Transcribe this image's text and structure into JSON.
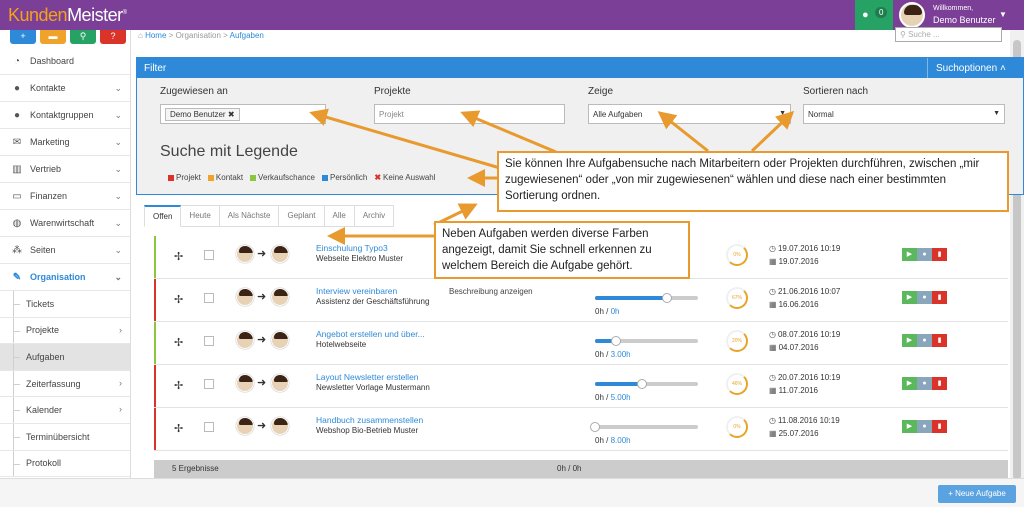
{
  "app": {
    "logo_kunden": "Kunden",
    "logo_meister": "Meister",
    "logo_mark": "®"
  },
  "header": {
    "notification_count": "0",
    "welcome": "Willkommen,",
    "user_name": "Demo Benutzer"
  },
  "colors": {
    "brand": "#7b3f97",
    "accent": "#2e8ad8",
    "notify": "#27a265",
    "callout_border": "#e89a2e"
  },
  "sidebar": {
    "quick_buttons": [
      {
        "icon": "plus-icon",
        "glyph": "+",
        "color": "#2e8ad8"
      },
      {
        "icon": "chat-icon",
        "glyph": "▬",
        "color": "#f0a32a"
      },
      {
        "icon": "search-icon",
        "glyph": "⚲",
        "color": "#27a265"
      },
      {
        "icon": "help-icon",
        "glyph": "?",
        "color": "#d9332a"
      }
    ],
    "items": [
      {
        "label": "Dashboard",
        "icon": "dashboard-icon",
        "glyph": "◔"
      },
      {
        "label": "Kontakte",
        "icon": "user-icon",
        "glyph": "●"
      },
      {
        "label": "Kontaktgruppen",
        "icon": "users-icon",
        "glyph": "●"
      },
      {
        "label": "Marketing",
        "icon": "envelope-icon",
        "glyph": "✉"
      },
      {
        "label": "Vertrieb",
        "icon": "bar-chart-icon",
        "glyph": "▥"
      },
      {
        "label": "Finanzen",
        "icon": "money-icon",
        "glyph": "▭"
      },
      {
        "label": "Warenwirtschaft",
        "icon": "globe-icon",
        "glyph": "◍"
      },
      {
        "label": "Seiten",
        "icon": "sitemap-icon",
        "glyph": "⁂"
      },
      {
        "label": "Organisation",
        "icon": "edit-icon",
        "glyph": "✎"
      }
    ],
    "subitems": [
      {
        "label": "Tickets"
      },
      {
        "label": "Projekte"
      },
      {
        "label": "Aufgaben"
      },
      {
        "label": "Zeiterfassung"
      },
      {
        "label": "Kalender"
      },
      {
        "label": "Terminübersicht"
      },
      {
        "label": "Protokoll"
      }
    ]
  },
  "breadcrumb": {
    "home": "Home",
    "sep": ">",
    "org": "Organisation",
    "current": "Aufgaben"
  },
  "search": {
    "placeholder": "Suche ..."
  },
  "filter": {
    "title": "Filter",
    "options": "Suchoptionen",
    "assigned_label": "Zugewiesen an",
    "assigned_tag": "Demo Benutzer",
    "projects_label": "Projekte",
    "projects_placeholder": "Projekt",
    "show_label": "Zeige",
    "show_value": "Alle Aufgaben",
    "sort_label": "Sortieren nach",
    "sort_value": "Normal",
    "legend_title": "Suche mit Legende",
    "legend": [
      {
        "label": "Projekt",
        "color": "#d9332a"
      },
      {
        "label": "Kontakt",
        "color": "#f0a32a"
      },
      {
        "label": "Verkaufschance",
        "color": "#8cc63f"
      },
      {
        "label": "Persönlich",
        "color": "#2e8ad8"
      },
      {
        "label": "Keine Auswahl",
        "color": "x"
      }
    ]
  },
  "tabs": [
    "Offen",
    "Heute",
    "Als Nächste",
    "Geplant",
    "Alle",
    "Archiv"
  ],
  "tasks": [
    {
      "title": "Einschulung Typo3",
      "sub": "Webseite Elektro Muster",
      "desc": "",
      "bar_color": "#8cc63f",
      "progress": 0,
      "done": "",
      "total": "",
      "percent": "0%",
      "due": "19.07.2016 10:19",
      "date": "19.07.2016"
    },
    {
      "title": "Interview vereinbaren",
      "sub": "Assistenz der Geschäftsführung",
      "desc": "Beschreibung anzeigen",
      "bar_color": "#d9332a",
      "progress": 0.7,
      "done": "0h",
      "total": "0h",
      "percent": "67%",
      "due": "21.06.2016 10:07",
      "date": "16.06.2016"
    },
    {
      "title": "Angebot erstellen und über...",
      "sub": "Hotelwebseite",
      "desc": "",
      "bar_color": "#8cc63f",
      "progress": 0.2,
      "done": "0h",
      "total": "3.00h",
      "percent": "20%",
      "due": "08.07.2016 10:19",
      "date": "04.07.2016"
    },
    {
      "title": "Layout Newsletter erstellen",
      "sub": "Newsletter Vorlage Mustermann",
      "desc": "",
      "bar_color": "#d9332a",
      "progress": 0.46,
      "done": "0h",
      "total": "5.00h",
      "percent": "46%",
      "due": "20.07.2016 10:19",
      "date": "11.07.2016"
    },
    {
      "title": "Handbuch zusammenstellen",
      "sub": "Webshop Bio-Betrieb Muster",
      "desc": "",
      "bar_color": "#d9332a",
      "progress": 0,
      "done": "0h",
      "total": "8.00h",
      "percent": "0%",
      "due": "11.08.2016 10:19",
      "date": "25.07.2016"
    }
  ],
  "summary": {
    "count": "5 Ergebnisse",
    "hours": "0h / 0h"
  },
  "new_task": "+ Neue Aufgabe",
  "callouts": {
    "filter": "Sie können Ihre Aufgabensuche nach Mitarbeitern oder Projekten durchführen, zwischen „mir zugewiesenen“ oder „von mir zugewiesenen“ wählen und diese nach einer bestimmten Sortierung ordnen.",
    "colors": "Neben Aufgaben werden diverse Farben angezeigt, damit Sie schnell erkennen zu welchem Bereich die Aufgabe gehört."
  }
}
